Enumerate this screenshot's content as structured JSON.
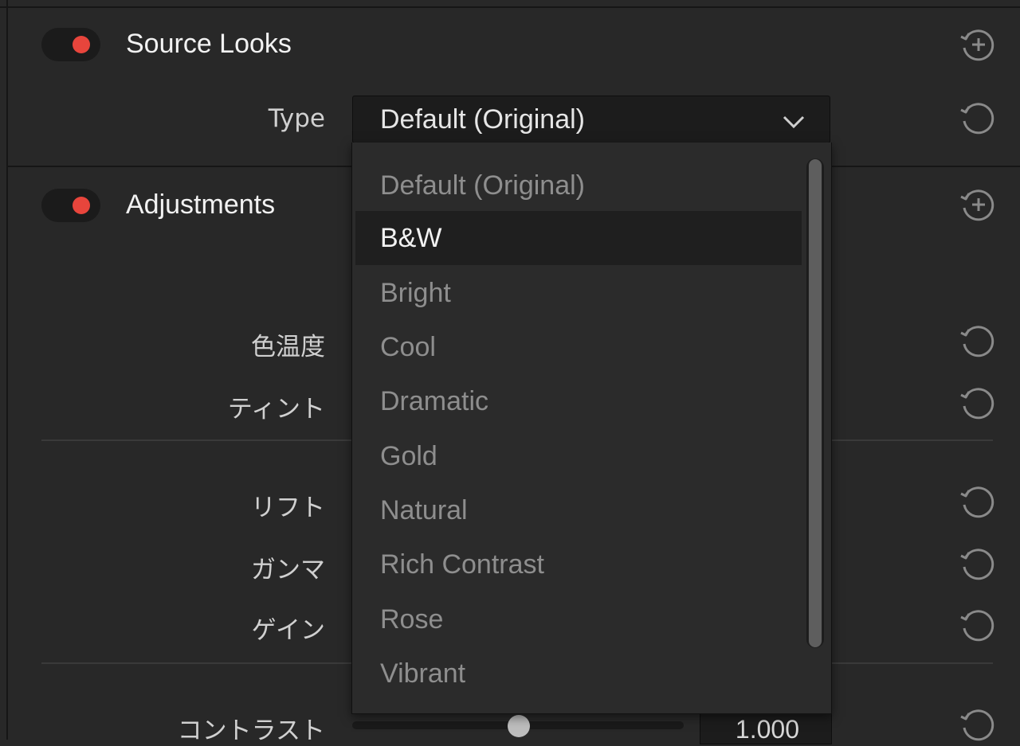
{
  "source_looks": {
    "title": "Source Looks",
    "enabled": true,
    "type_label": "Type",
    "type_value": "Default (Original)"
  },
  "dropdown": {
    "options": [
      "Default (Original)",
      "B&W",
      "Bright",
      "Cool",
      "Dramatic",
      "Gold",
      "Natural",
      "Rich Contrast",
      "Rose",
      "Vibrant"
    ],
    "hovered": "B&W"
  },
  "adjustments": {
    "title": "Adjustments",
    "enabled": true,
    "color_temperature_label": "色温度",
    "tint_label": "ティント",
    "lift_label": "リフト",
    "gamma_label": "ガンマ",
    "gain_label": "ゲイン",
    "contrast_label": "コントラスト",
    "contrast_value": "1.000"
  },
  "colors": {
    "toggle_on": "#e8453c",
    "panel_bg": "#282828"
  },
  "icons": {
    "add": "add-circle-icon",
    "reset": "reset-icon",
    "chevron": "chevron-down-icon"
  }
}
